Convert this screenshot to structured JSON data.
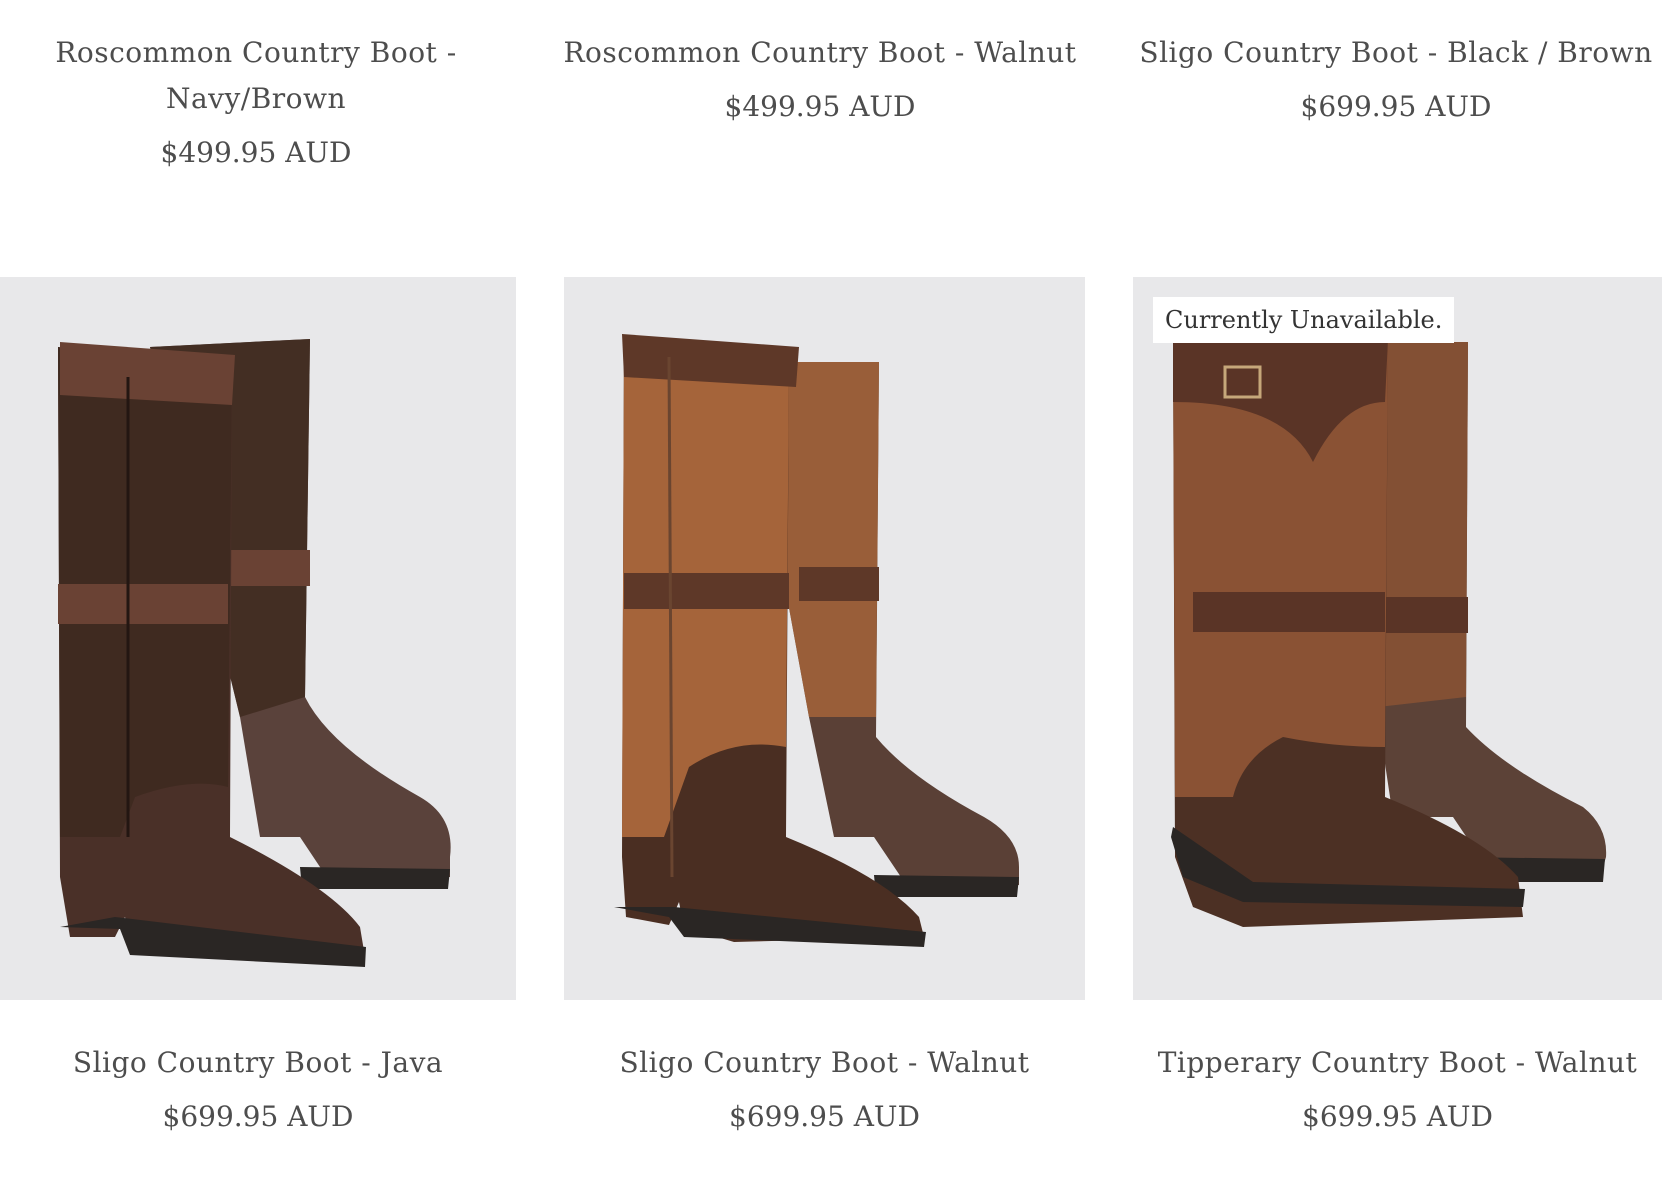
{
  "top_row": [
    {
      "title": "Roscommon Country Boot -",
      "title2": "Navy/Brown",
      "price": "$499.95 AUD"
    },
    {
      "title": "Roscommon Country Boot - Walnut",
      "price": "$499.95 AUD"
    },
    {
      "title": "Sligo Country Boot - Black / Brown",
      "price": "$699.95 AUD"
    }
  ],
  "products": [
    {
      "title": "Sligo Country Boot - Java",
      "price": "$699.95 AUD",
      "upper_color": "#3f2a20",
      "lower_color": "#4a3028",
      "strap_color": "#6a4234"
    },
    {
      "title": "Sligo Country Boot - Walnut",
      "price": "$699.95 AUD",
      "upper_color": "#a5643a",
      "lower_color": "#4a2e22",
      "strap_color": "#5e3828"
    },
    {
      "title": "Tipperary Country Boot - Walnut",
      "price": "$699.95 AUD",
      "badge": "Currently Unavailable.",
      "upper_color": "#8a5234",
      "lower_color": "#4c3024",
      "strap_color": "#5a3426"
    }
  ],
  "colors": {
    "card_bg": "#e8e8ea",
    "text": "#4d4d4d",
    "sole": "#2a2624"
  }
}
